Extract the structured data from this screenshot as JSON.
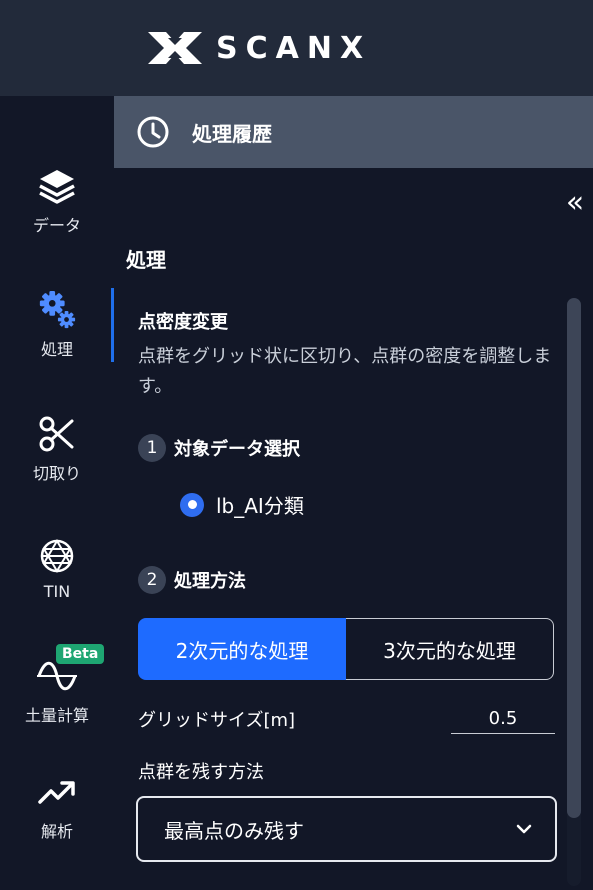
{
  "brand": {
    "name": "SCANX"
  },
  "history": {
    "title": "処理履歴"
  },
  "sidebar": {
    "items": [
      {
        "label": "データ",
        "icon": "layers-icon"
      },
      {
        "label": "処理",
        "icon": "gears-icon"
      },
      {
        "label": "切取り",
        "icon": "scissors-icon"
      },
      {
        "label": "TIN",
        "icon": "mesh-icon"
      },
      {
        "label": "土量計算",
        "icon": "wave-icon",
        "badge": "Beta"
      },
      {
        "label": "解析",
        "icon": "trend-icon"
      }
    ]
  },
  "panel": {
    "collapse_icon": "«",
    "section_title": "処理",
    "card_title": "点密度変更",
    "card_desc": "点群をグリッド状に区切り、点群の密度を調整します。",
    "step1": {
      "num": "1",
      "label": "対象データ選択"
    },
    "target_data": "lb_AI分類",
    "step2": {
      "num": "2",
      "label": "処理方法"
    },
    "method_options": [
      "2次元的な処理",
      "3次元的な処理"
    ],
    "grid_size_label": "グリッドサイズ[m]",
    "grid_size_value": "0.5",
    "keep_label": "点群を残す方法",
    "keep_value": "最高点のみ残す"
  },
  "colors": {
    "accent": "#1e6bff",
    "badge": "#1ea672",
    "background": "#121727",
    "topbar": "#222a3a",
    "history_bar": "#4a5568"
  }
}
